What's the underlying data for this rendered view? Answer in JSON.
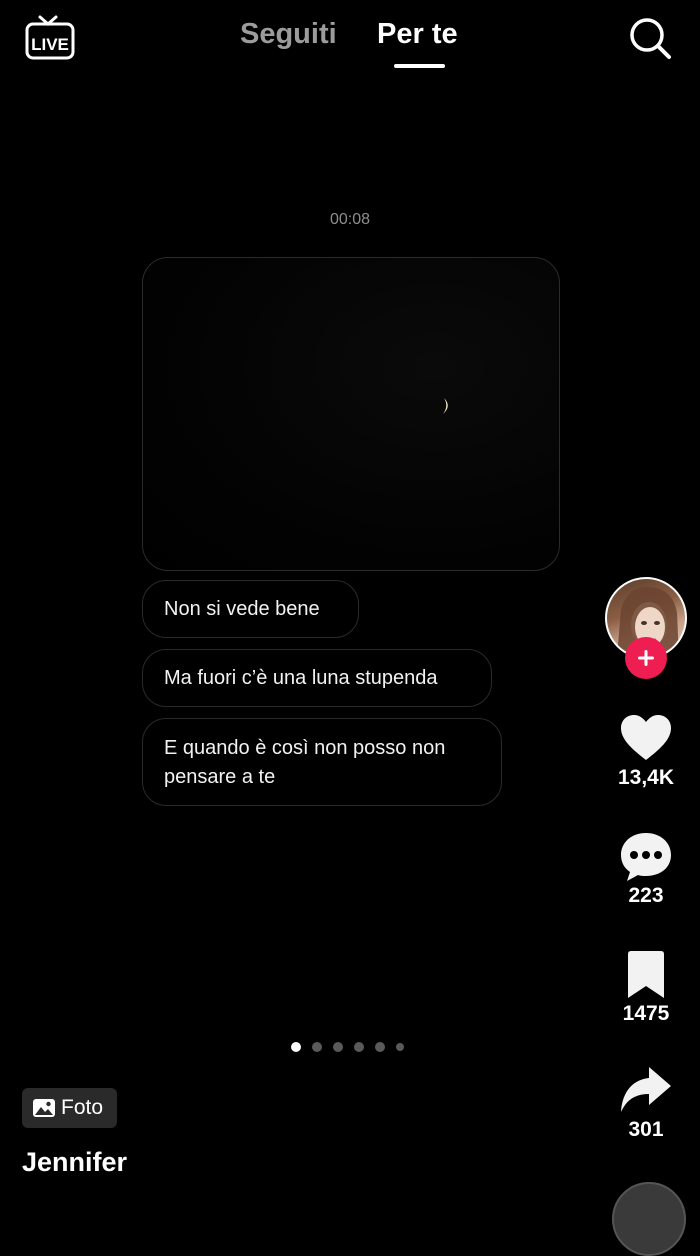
{
  "header": {
    "live_label": "LIVE",
    "tabs": [
      {
        "label": "Seguiti",
        "active": false
      },
      {
        "label": "Per te",
        "active": true
      }
    ]
  },
  "post": {
    "timestamp": "00:08",
    "messages": [
      {
        "text": "Non si vede bene"
      },
      {
        "text": "Ma fuori c’è una luna stupenda"
      },
      {
        "text_lines": [
          "E quando è così non posso non",
          "pensare a te"
        ]
      }
    ],
    "carousel": {
      "total": 6,
      "current": 1
    }
  },
  "actions": {
    "likes": "13,4K",
    "comments": "223",
    "saves": "1475",
    "shares": "301"
  },
  "footer": {
    "badge_label": "Foto",
    "author": "Jennifer"
  },
  "colors": {
    "background": "#000000",
    "follow_button": "#ee1d52",
    "inactive_tab": "#9c9c9c"
  }
}
